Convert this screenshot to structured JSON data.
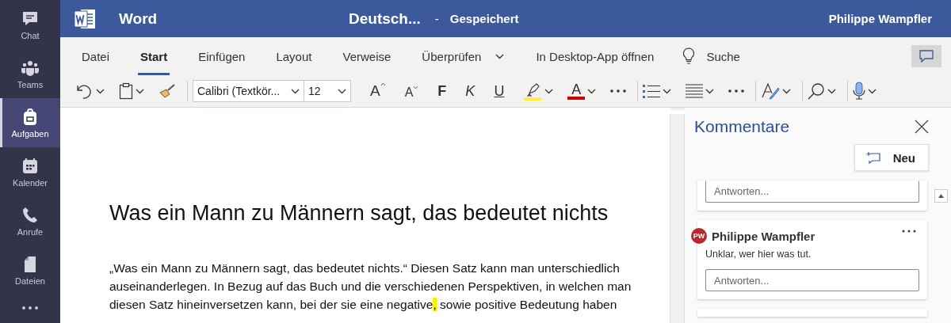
{
  "rail": {
    "items": [
      {
        "kind": "chat",
        "label": "Chat",
        "selected": false
      },
      {
        "kind": "teams",
        "label": "Teams",
        "selected": false
      },
      {
        "kind": "tasks",
        "label": "Aufgaben",
        "selected": true
      },
      {
        "kind": "calendar",
        "label": "Kalender",
        "selected": false
      },
      {
        "kind": "calls",
        "label": "Anrufe",
        "selected": false
      },
      {
        "kind": "files",
        "label": "Dateien",
        "selected": false
      }
    ]
  },
  "header": {
    "app": "Word",
    "document": "Deutsch...",
    "separator": "-",
    "status": "Gespeichert",
    "user": "Philippe Wampfler"
  },
  "ribbon": {
    "tabs": [
      {
        "label": "Datei",
        "selected": false
      },
      {
        "label": "Start",
        "selected": true
      },
      {
        "label": "Einfügen",
        "selected": false
      },
      {
        "label": "Layout",
        "selected": false
      },
      {
        "label": "Verweise",
        "selected": false
      },
      {
        "label": "Überprüfen",
        "selected": false
      }
    ],
    "open_desktop": "In Desktop-App öffnen",
    "search": "Suche"
  },
  "toolbar": {
    "font": "Calibri (Textkör...",
    "size": "12",
    "grow": "A",
    "shrink": "A",
    "bold": "F",
    "italic": "K",
    "underline": "U",
    "font_color": "A"
  },
  "document": {
    "title": "Was ein Mann zu Männern sagt, das bedeutet nichts",
    "paragraph": [
      {
        "text": "„Was ein Mann zu Männern sagt, das bedeutet nichts.“ Diesen Satz kann man unterschiedlich auseinanderlegen. In Bezug auf das Buch und die verschiedenen Perspektiven, in welchen man diesen Satz hineinversetzen kann, bei der sie eine negative",
        "highlighted": false
      },
      {
        "text": ",",
        "highlighted": true
      },
      {
        "text": " sowie positive Bedeutung haben",
        "highlighted": false
      }
    ]
  },
  "comments": {
    "title": "Kommentare",
    "new_button": "Neu",
    "cards": [
      {
        "kind": "reply",
        "placeholder": "Antworten..."
      },
      {
        "kind": "comment",
        "initials": "PW",
        "author": "Philippe Wampfler",
        "text": "Unklar, wer hier was tut.",
        "placeholder": "Antworten..."
      }
    ]
  }
}
